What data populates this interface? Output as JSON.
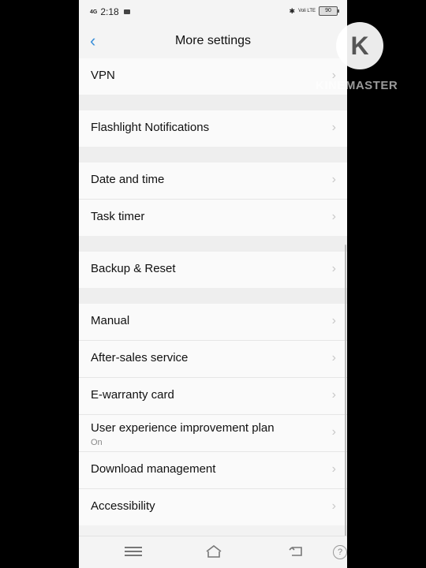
{
  "status_bar": {
    "network": "4G",
    "time": "2:18",
    "volte": "Voli LTE",
    "battery": "90"
  },
  "header": {
    "title": "More settings"
  },
  "groups": [
    {
      "items": [
        {
          "label": "VPN"
        }
      ]
    },
    {
      "items": [
        {
          "label": "Flashlight Notifications"
        }
      ]
    },
    {
      "items": [
        {
          "label": "Date and time"
        },
        {
          "label": "Task timer"
        }
      ]
    },
    {
      "items": [
        {
          "label": "Backup & Reset"
        }
      ]
    },
    {
      "items": [
        {
          "label": "Manual"
        },
        {
          "label": "After-sales service"
        },
        {
          "label": "E-warranty card"
        },
        {
          "label": "User experience improvement plan",
          "sub": "On"
        },
        {
          "label": "Download management"
        },
        {
          "label": "Accessibility"
        }
      ]
    }
  ],
  "watermark": {
    "logo": "K",
    "text": "KINEMASTER"
  },
  "nav": {
    "help": "?"
  }
}
